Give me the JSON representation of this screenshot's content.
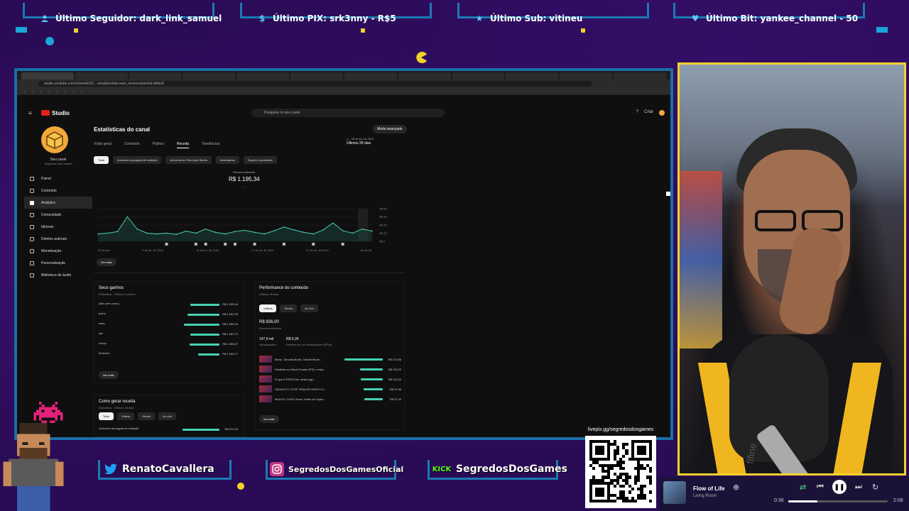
{
  "alerts": [
    {
      "icon": "user-icon",
      "text": "Último Seguidor: dark_link_samuel"
    },
    {
      "icon": "dollar-icon",
      "text": "Último PIX: srk3nny - R$5"
    },
    {
      "icon": "star-icon",
      "text": "Último Sub: vitineu"
    },
    {
      "icon": "heart-icon",
      "text": "Último Bit: yankee_channel - 50"
    }
  ],
  "browser": {
    "url": "studio.youtube.com/channel/UC.../analytics/tab-earn_revenue/period-default",
    "search_placeholder": "Pesquise no seu canal",
    "studio_label": "Studio",
    "create_label": "Criar"
  },
  "sidebar": {
    "channel_name": "Seu canal",
    "channel_sub": "Segredos dos Games",
    "items": [
      {
        "label": "Painel",
        "icon": "dashboard-icon"
      },
      {
        "label": "Conteúdo",
        "icon": "content-icon"
      },
      {
        "label": "Analytics",
        "icon": "analytics-icon"
      },
      {
        "label": "Comunidade",
        "icon": "community-icon"
      },
      {
        "label": "Idiomas",
        "icon": "subtitles-icon"
      },
      {
        "label": "Direitos autorais",
        "icon": "copyright-icon"
      },
      {
        "label": "Monetização",
        "icon": "monetization-icon"
      },
      {
        "label": "Personalização",
        "icon": "customization-icon"
      },
      {
        "label": "Biblioteca de áudio",
        "icon": "audio-library-icon"
      }
    ]
  },
  "main": {
    "title": "Estatísticas do canal",
    "advanced_mode": "Modo avançado",
    "date_range_line1": "1 – 28 de jul. de 2024",
    "date_range_line2": "Últimos 28 dias",
    "tabs": [
      "Visão geral",
      "Conteúdo",
      "Público",
      "Receita",
      "Tendências"
    ],
    "active_tab": 3,
    "chips": [
      "Tudo",
      "Anúncios da página de exibição",
      "Anúncios do Feed dos Shorts",
      "Assinaturas",
      "Supers e presentes"
    ],
    "revenue_label": "Receita estimada",
    "revenue_value": "R$ 1.195,34",
    "revenue_sub": "—",
    "chart_ticks_x": [
      "30 de jun.",
      "5 de jul. de 2024",
      "11 de jul. de 2024",
      "17 de jul. de 2024",
      "21 de jul. de 2024",
      "26 de jul."
    ],
    "chart_ticks_y": [
      "R$ 80",
      "R$ 60",
      "R$ 40",
      "R$ 20",
      "R$ 0"
    ],
    "see_more": "Ver mais"
  },
  "earnings": {
    "title": "Seus ganhos",
    "subtitle": "Estimativa · Últimos 6 meses",
    "rows": [
      {
        "label": "julho (em curso)",
        "amount": "R$ 1.195,34",
        "frac": 0.78
      },
      {
        "label": "junho",
        "amount": "R$ 1.652,49",
        "frac": 0.86
      },
      {
        "label": "maio",
        "amount": "R$ 1.505,29",
        "frac": 0.96
      },
      {
        "label": "abr.",
        "amount": "R$ 1.281,74",
        "frac": 0.78
      },
      {
        "label": "março",
        "amount": "R$ 1.356,37",
        "frac": 0.8
      },
      {
        "label": "fevereiro",
        "amount": "R$ 1.160,77",
        "frac": 0.58
      }
    ],
    "see_more": "Ver mais"
  },
  "how_earn": {
    "title": "Como gerar receita",
    "subtitle": "Estimativa · Últimos 28 dias",
    "chips": [
      "Tudo",
      "Vídeos",
      "Shorts",
      "Ao vivo"
    ],
    "row_label": "Anúncios da página de exibição",
    "row_amount": "R$ 874,53"
  },
  "performance": {
    "title": "Performance do conteúdo",
    "subtitle": "Últimos 28 dias",
    "chips": [
      "Vídeos",
      "Shorts",
      "Ao vivo"
    ],
    "value": "R$ 926,00",
    "value_sub": "Receita estimada",
    "views": "147,9 mil",
    "rpm": "R$ 6,26",
    "views_label": "Visualizações",
    "rpm_label": "Receita por mil visualizações (RPM)",
    "rows": [
      {
        "title": "Mario, Tanooki Mode, Citadel Mode...",
        "amount": "R$ 170,56",
        "frac": 1.0
      },
      {
        "title": "Detalhes no Mural Tocado (PS) e mais...",
        "amount": "R$ 116,30",
        "frac": 0.6
      },
      {
        "title": "O que é ESPECIAL neste jogo...",
        "amount": "R$ 114,00",
        "frac": 0.58
      },
      {
        "title": "SAGACITY CUTE TRAILER HEROY A...",
        "amount": "R$ 97,96",
        "frac": 0.5
      },
      {
        "title": "MUDOU TUDO! Novo Trailer do Super...",
        "amount": "R$ 97,00",
        "frac": 0.49
      }
    ],
    "see_more": "Ver mais"
  },
  "socials": [
    {
      "icon": "twitter-icon",
      "text": "RenatoCavallera",
      "color": "#1da1f2"
    },
    {
      "icon": "instagram-icon",
      "text": "SegredosDosGamesOficial",
      "color": "#c13584"
    },
    {
      "icon": "kick-icon",
      "text": "SegredosDosGames",
      "color": "#53fc18"
    }
  ],
  "qr_label": "livepix.gg/segredosdosgames",
  "player": {
    "title": "Flow of Life",
    "artist": "Living Room",
    "elapsed": "0:36",
    "total": "2:08",
    "progress": 0.29
  },
  "webcam": {
    "brand": "fifine"
  },
  "chart_data": {
    "type": "line",
    "values": [
      18,
      20,
      24,
      60,
      30,
      20,
      18,
      20,
      17,
      25,
      20,
      30,
      22,
      18,
      24,
      27,
      22,
      18,
      26,
      35,
      28,
      22,
      18,
      28,
      45,
      26,
      20,
      30,
      25
    ],
    "ylim": [
      0,
      80
    ]
  }
}
